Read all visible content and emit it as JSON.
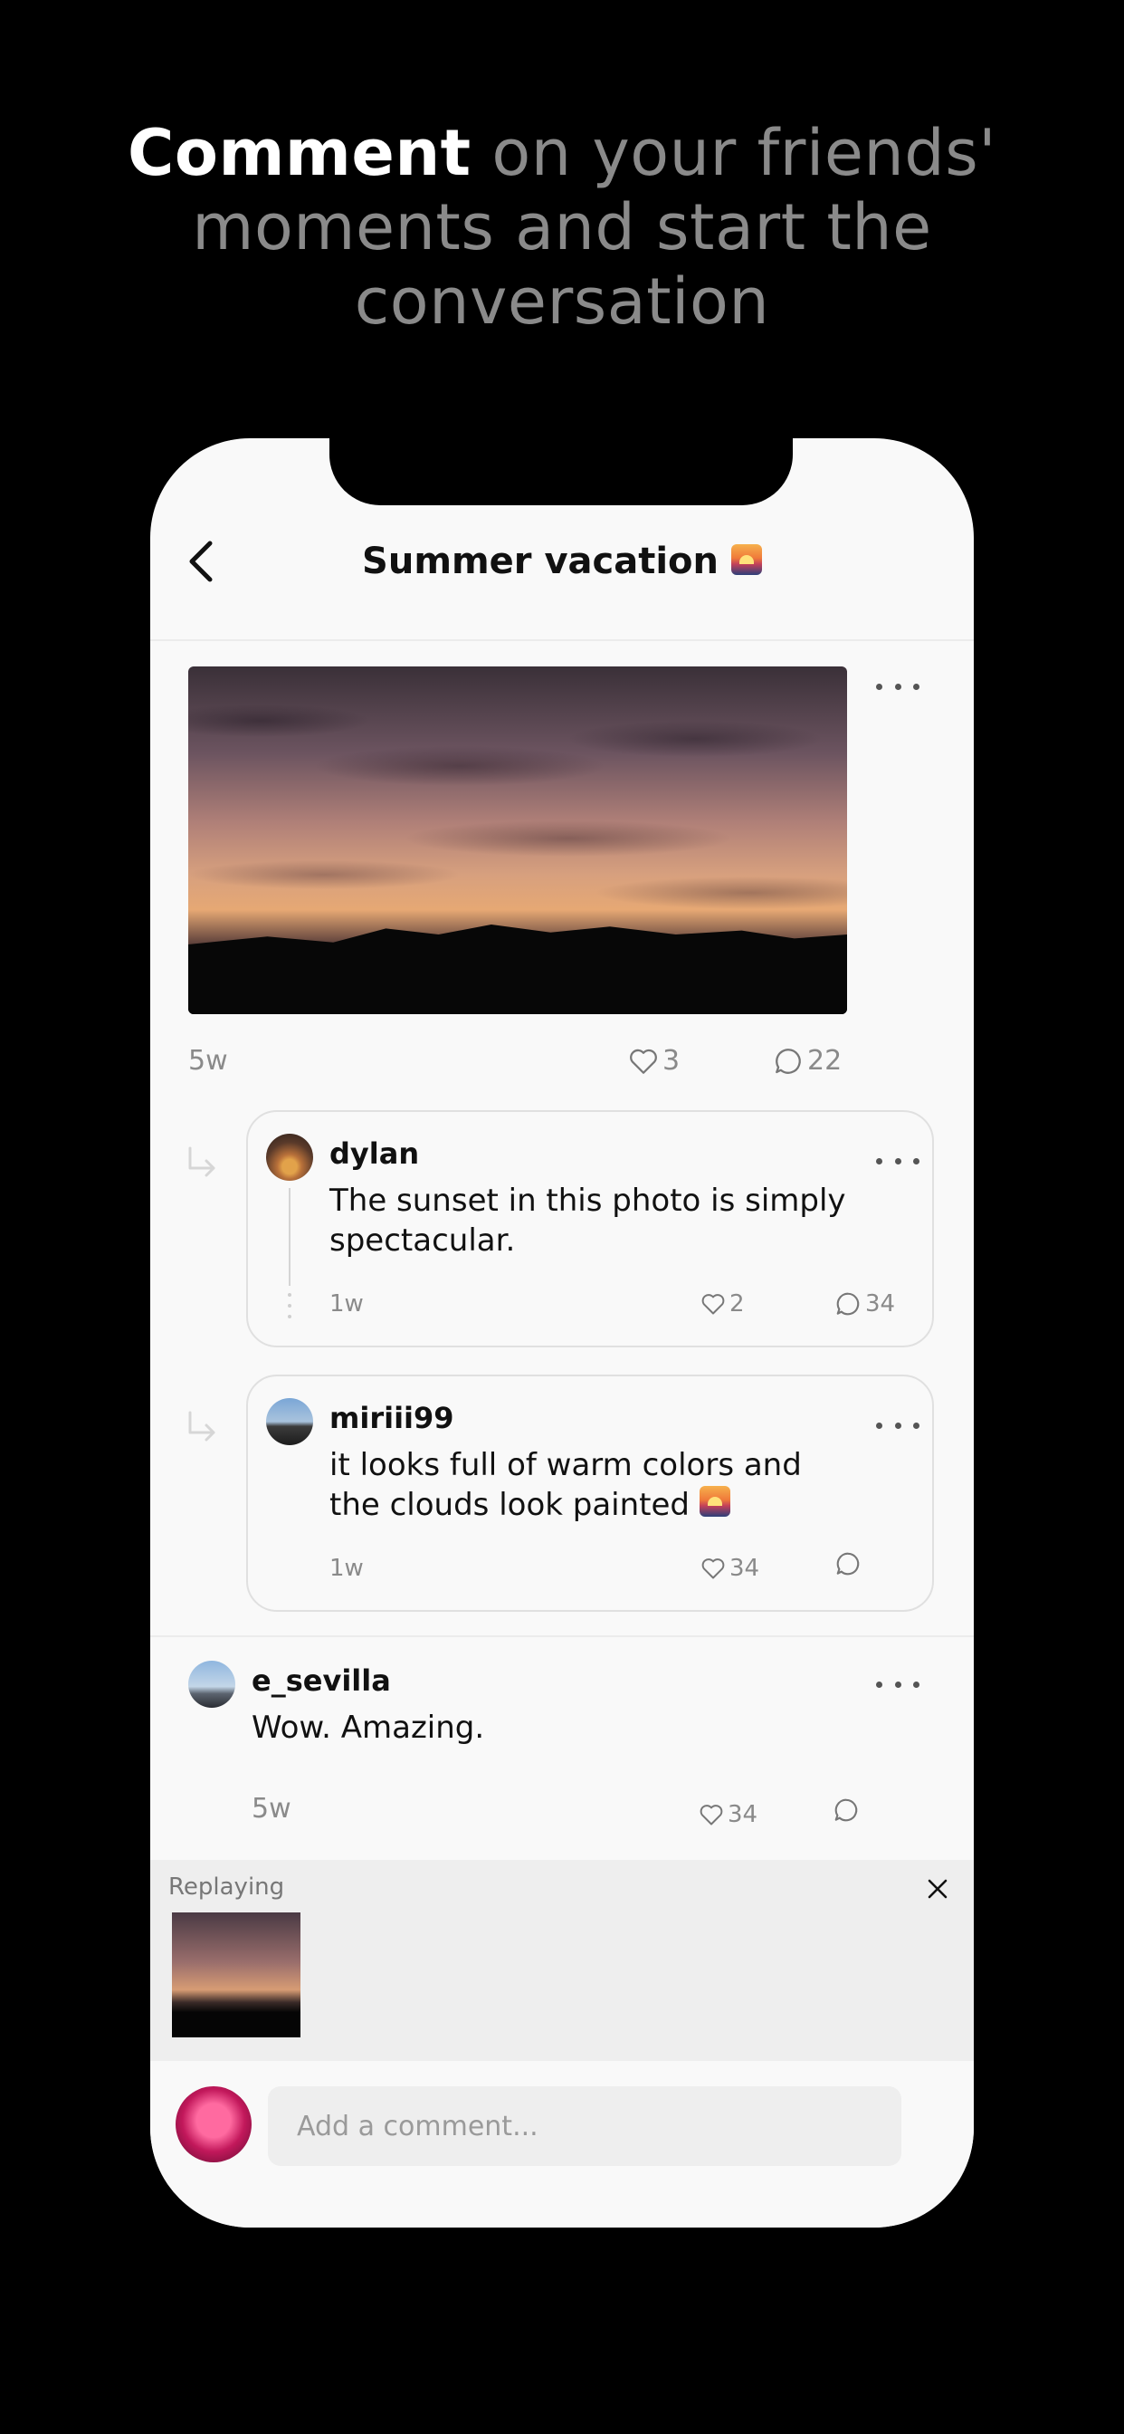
{
  "headline": {
    "bold": "Comment",
    "rest": " on your friends' moments and start the conversation"
  },
  "nav": {
    "title": "Summer vacation",
    "title_emoji": "sunset-emoji",
    "back_icon": "chevron-left-icon"
  },
  "post": {
    "age": "5w",
    "likes": "3",
    "comments": "22"
  },
  "replies": [
    {
      "username": "dylan",
      "text": "The sunset in this photo is simply spectacular.",
      "age": "1w",
      "likes": "2",
      "comments": "34"
    },
    {
      "username": "miriii99",
      "text": "it looks full of warm colors and the clouds look painted",
      "age": "1w",
      "likes": "34",
      "comments": ""
    }
  ],
  "comment": {
    "username": "e_sevilla",
    "text": "Wow. Amazing.",
    "age": "5w",
    "likes": "34",
    "comments": ""
  },
  "replying": {
    "label": "Replaying"
  },
  "composer": {
    "placeholder": "Add a comment..."
  },
  "colors": {
    "background": "#000000",
    "screen": "#f9f9f9",
    "muted_text": "#8a8a8a",
    "panel": "#eeeeee"
  }
}
